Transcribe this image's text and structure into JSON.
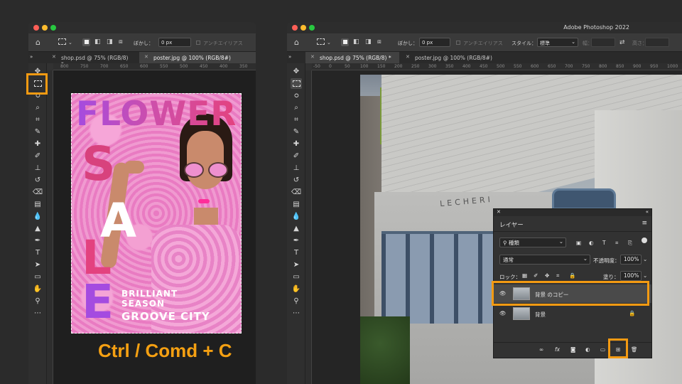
{
  "left_window": {
    "options": {
      "feather_label": "ぼかし：",
      "feather_value": "0 px",
      "antialias_label": "アンチエイリアス"
    },
    "tabs": [
      {
        "label": "shop.psd @ 75% (RGB/8) *",
        "active": false
      },
      {
        "label": "poster.jpg @ 100% (RGB/8#)",
        "active": true
      }
    ],
    "ruler_ticks": [
      "800",
      "750",
      "700",
      "650",
      "600",
      "550",
      "500",
      "450",
      "400",
      "350"
    ],
    "poster": {
      "title": "FLOWER",
      "sale_letters": [
        "S",
        "A",
        "L",
        "E"
      ],
      "lines": [
        "BRILLIANT",
        "SEASON",
        "GROOVE CITY"
      ]
    },
    "shortcut_caption": "Ctrl / Comd + C"
  },
  "right_window": {
    "app_title": "Adobe Photoshop 2022",
    "options": {
      "feather_label": "ぼかし：",
      "feather_value": "0 px",
      "antialias_label": "アンチエイリアス",
      "style_label": "スタイル：",
      "style_value": "標準",
      "width_label": "幅：",
      "height_label": "高さ："
    },
    "tabs": [
      {
        "label": "shop.psd @ 75% (RGB/8) *",
        "active": true
      },
      {
        "label": "poster.jpg @ 100% (RGB/8#)",
        "active": false
      }
    ],
    "ruler_ticks": [
      "-50",
      "0",
      "50",
      "100",
      "150",
      "200",
      "250",
      "300",
      "350",
      "400",
      "450",
      "500",
      "550",
      "600",
      "650",
      "700",
      "750",
      "800",
      "850",
      "900",
      "950",
      "1000"
    ],
    "storefront_sign": "LECHERI",
    "layers_panel": {
      "title": "レイヤー",
      "filter_value": "種類",
      "blend_mode": "通常",
      "opacity_label": "不透明度：",
      "opacity_value": "100%",
      "lock_label": "ロック：",
      "fill_label": "塗り：",
      "fill_value": "100%",
      "layers": [
        {
          "name": "背景 のコピー",
          "selected": true,
          "locked": false
        },
        {
          "name": "背景",
          "selected": false,
          "locked": true
        }
      ]
    }
  },
  "colors": {
    "highlight": "#f39a12",
    "poster_purple": "#a44be0",
    "poster_red": "#e3427f"
  }
}
